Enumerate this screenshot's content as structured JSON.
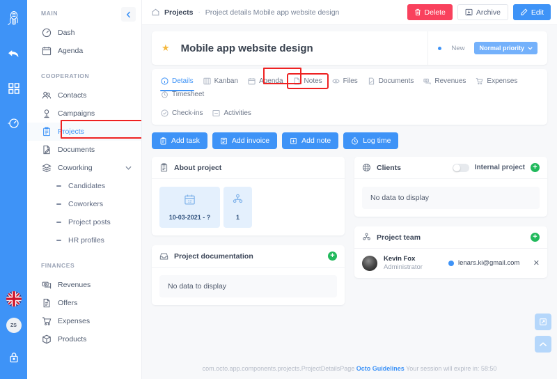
{
  "rail": {
    "logo_icon": "octopus-logo-icon",
    "icons": [
      {
        "name": "undo-arrow-icon"
      },
      {
        "name": "grid-apps-icon"
      },
      {
        "name": "speedometer-icon"
      }
    ],
    "flag": "uk-flag-icon",
    "avatar_initials": "ZS",
    "lock_icon": "lock-icon"
  },
  "sidebar": {
    "collapse_icon": "chevron-left-icon",
    "groups": [
      {
        "title": "MAIN",
        "items": [
          {
            "label": "Dash",
            "icon": "dashboard-icon",
            "active": false
          },
          {
            "label": "Agenda",
            "icon": "calendar-icon",
            "active": false
          }
        ]
      },
      {
        "title": "COOPERATION",
        "items": [
          {
            "label": "Contacts",
            "icon": "contacts-icon",
            "active": false
          },
          {
            "label": "Campaigns",
            "icon": "campaign-icon",
            "active": false
          },
          {
            "label": "Projects",
            "icon": "clipboard-icon",
            "active": true
          },
          {
            "label": "Documents",
            "icon": "document-edit-icon",
            "active": false
          },
          {
            "label": "Coworking",
            "icon": "layers-icon",
            "active": false,
            "expandable": true
          }
        ],
        "subitems": [
          {
            "label": "Candidates"
          },
          {
            "label": "Coworkers"
          },
          {
            "label": "Project posts"
          },
          {
            "label": "HR profiles"
          }
        ]
      },
      {
        "title": "FINANCES",
        "items": [
          {
            "label": "Revenues",
            "icon": "money-stack-icon",
            "active": false
          },
          {
            "label": "Offers",
            "icon": "offer-doc-icon",
            "active": false
          },
          {
            "label": "Expenses",
            "icon": "cart-icon",
            "active": false
          },
          {
            "label": "Products",
            "icon": "box-icon",
            "active": false
          }
        ]
      }
    ]
  },
  "topbar": {
    "home_icon": "home-icon",
    "breadcrumb_root": "Projects",
    "breadcrumb_separator": "·",
    "breadcrumb_current": "Project details Mobile app website design",
    "delete_label": "Delete",
    "delete_icon": "trash-icon",
    "delete_color": "#f9415d",
    "archive_label": "Archive",
    "archive_icon": "archive-box-icon",
    "edit_label": "Edit",
    "edit_icon": "pencil-icon",
    "edit_color": "#3e93f7"
  },
  "title_card": {
    "star_icon": "star-icon",
    "title": "Mobile app website design",
    "status_label": "New",
    "status_color": "#3e93f7",
    "priority_label": "Normal priority",
    "priority_caret": "chevron-down-icon"
  },
  "tabs": [
    {
      "label": "Details",
      "icon": "info-circle-icon",
      "active": true,
      "highlighted": false
    },
    {
      "label": "Kanban",
      "icon": "kanban-board-icon",
      "active": false,
      "highlighted": false
    },
    {
      "label": "Agenda",
      "icon": "calendar-icon",
      "active": false,
      "highlighted": false
    },
    {
      "label": "Notes",
      "icon": "note-icon",
      "active": false,
      "highlighted": true
    },
    {
      "label": "Files",
      "icon": "paperclip-icon",
      "active": false,
      "highlighted": false
    },
    {
      "label": "Documents",
      "icon": "document-icon",
      "active": false,
      "highlighted": false
    },
    {
      "label": "Revenues",
      "icon": "money-icon",
      "active": false,
      "highlighted": false
    },
    {
      "label": "Expenses",
      "icon": "cart-icon",
      "active": false,
      "highlighted": false
    },
    {
      "label": "Timesheet",
      "icon": "timesheet-icon",
      "active": false,
      "highlighted": false
    },
    {
      "label": "Check-ins",
      "icon": "checkin-icon",
      "active": false,
      "highlighted": false
    },
    {
      "label": "Activities",
      "icon": "activities-icon",
      "active": false,
      "highlighted": false
    }
  ],
  "actions": [
    {
      "label": "Add task",
      "icon": "task-clipboard-icon"
    },
    {
      "label": "Add invoice",
      "icon": "invoice-icon"
    },
    {
      "label": "Add note",
      "icon": "add-note-icon"
    },
    {
      "label": "Log time",
      "icon": "stopwatch-icon"
    }
  ],
  "about_project": {
    "heading": "About project",
    "heading_icon": "clipboard-icon",
    "stats": [
      {
        "icon": "calendar-icon",
        "value": "10-03-2021 - ?"
      },
      {
        "icon": "team-icon",
        "value": "1"
      }
    ]
  },
  "project_documentation": {
    "heading": "Project documentation",
    "heading_icon": "inbox-icon",
    "add_icon": "plus-circle-icon",
    "empty_text": "No data to display"
  },
  "clients": {
    "heading": "Clients",
    "heading_icon": "globe-users-icon",
    "toggle_label": "Internal project",
    "toggle_on": false,
    "add_icon": "plus-circle-icon",
    "empty_text": "No data to display"
  },
  "project_team": {
    "heading": "Project team",
    "heading_icon": "team-icon",
    "add_icon": "plus-circle-icon",
    "members": [
      {
        "avatar": "user-photo-avatar",
        "name": "Kevin Fox",
        "role": "Administrator",
        "email": "lenars.ki@gmail.com",
        "email_dot_color": "#3e93f7",
        "remove_icon": "close-icon"
      }
    ]
  },
  "footer": {
    "component_path": "com.octo.app.components.projects.ProjectDetailsPage",
    "link_label": "Octo Guidelines",
    "session_text": "Your session will expire in: 58:50"
  },
  "fabs": [
    {
      "name": "resize-icon",
      "glyph": "resize"
    },
    {
      "name": "scroll-top-icon",
      "glyph": "caret-up"
    }
  ]
}
